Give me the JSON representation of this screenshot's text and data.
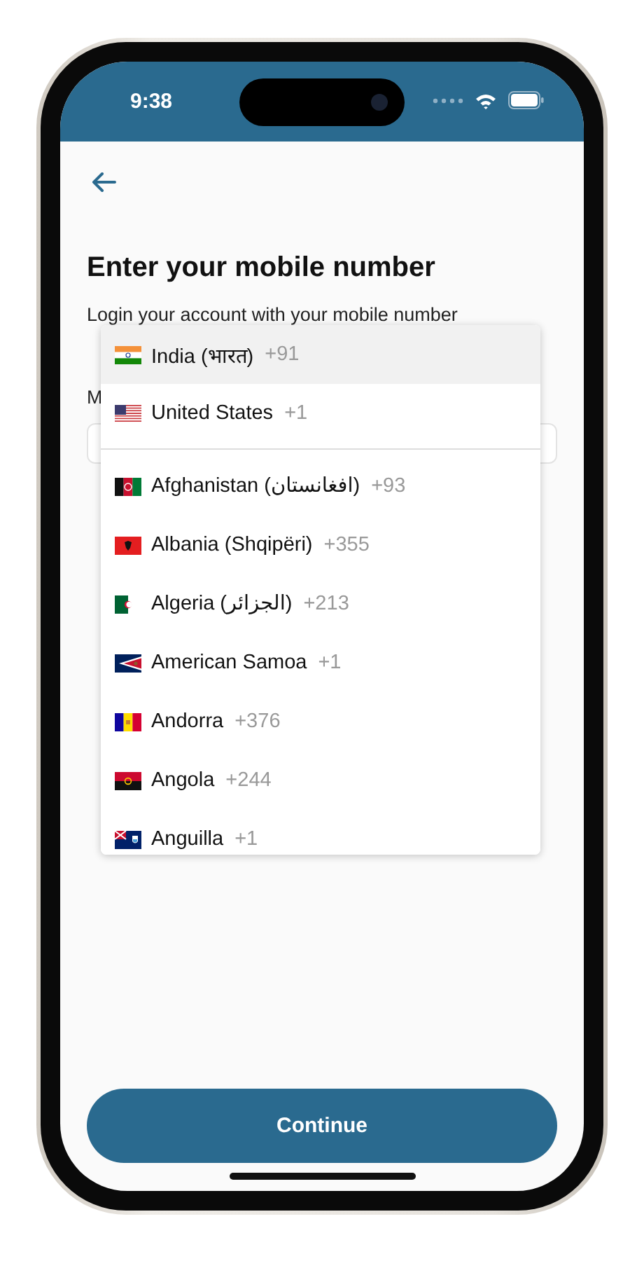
{
  "status_bar": {
    "time": "9:38"
  },
  "title": "Enter your mobile number",
  "subtitle": "Login your account with your mobile number",
  "phone_label": "M",
  "country_menu": {
    "preferred": [
      {
        "name": "India (भारत)",
        "code": "+91",
        "selected": true
      },
      {
        "name": "United States",
        "code": "+1",
        "selected": false
      }
    ],
    "countries": [
      {
        "name": "Afghanistan (‫افغانستان‬‎)",
        "code": "+93",
        "selected": false
      },
      {
        "name": "Albania (Shqipëri)",
        "code": "+355",
        "selected": false
      },
      {
        "name": "Algeria (‫الجزائر‬‎)",
        "code": "+213",
        "selected": false
      },
      {
        "name": "American Samoa",
        "code": "+1",
        "selected": false
      },
      {
        "name": "Andorra",
        "code": "+376",
        "selected": false
      },
      {
        "name": "Angola",
        "code": "+244",
        "selected": false
      },
      {
        "name": "Anguilla",
        "code": "+1",
        "selected": false
      }
    ]
  },
  "continue_button": "Continue"
}
